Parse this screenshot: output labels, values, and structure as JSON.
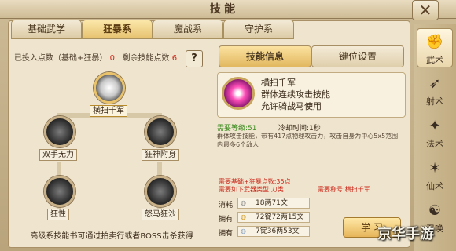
{
  "window": {
    "title": "技能",
    "close_glyph": "✕"
  },
  "tabs": [
    {
      "label": "基础武学"
    },
    {
      "label": "狂暴系",
      "active": true
    },
    {
      "label": "魔战系"
    },
    {
      "label": "守护系"
    }
  ],
  "points": {
    "invested_label": "已投入点数（基础+狂暴）",
    "invested_value": "0",
    "remaining_label": "剩余技能点数",
    "remaining_value": "6",
    "help_label": "?"
  },
  "tree": [
    {
      "label": "横扫千军"
    },
    {
      "label": "双手无力"
    },
    {
      "label": "狂神附身"
    },
    {
      "label": "狂性"
    },
    {
      "label": "怒马狂沙"
    }
  ],
  "tree_footer": "高级系技能书可通过拍卖行或者BOSS击杀获得",
  "right_tabs": [
    {
      "label": "技能信息"
    },
    {
      "label": "键位设置"
    }
  ],
  "skill": {
    "name": "横扫千军",
    "desc1": "群体连续攻击技能",
    "desc2": "允许骑战马使用",
    "req_level": "需要等级:51",
    "cooldown": "冷却时间:1秒",
    "details": "群体攻击技能，带有417点物理攻击力，攻击自身为中心5x5范围内最多6个敌人",
    "req_points": "需要基础+狂暴点数:35点",
    "req_weapon": "需要如下武器类型:刀类",
    "req_title": "需要称号:横扫千军"
  },
  "costs": [
    {
      "label": "消耗",
      "value": "18两71文"
    },
    {
      "label": "拥有",
      "value": "72锭72两15文"
    },
    {
      "label": "拥有",
      "value": "7锭36两53文"
    }
  ],
  "learn_label": "学 习",
  "sidebar": [
    {
      "label": "武术",
      "icon": "fist-icon",
      "glyph": "✊",
      "active": true
    },
    {
      "label": "射术",
      "icon": "bow-icon",
      "glyph": "➶"
    },
    {
      "label": "法术",
      "icon": "flame-icon",
      "glyph": "✦"
    },
    {
      "label": "仙术",
      "icon": "star-icon",
      "glyph": "✶"
    },
    {
      "label": "召唤",
      "icon": "summon-icon",
      "glyph": "☯"
    }
  ],
  "watermark": "京华手游",
  "colors": {
    "accent": "#e6c270",
    "red_text": "#cc2a1c",
    "green_text": "#3c8b1e"
  }
}
